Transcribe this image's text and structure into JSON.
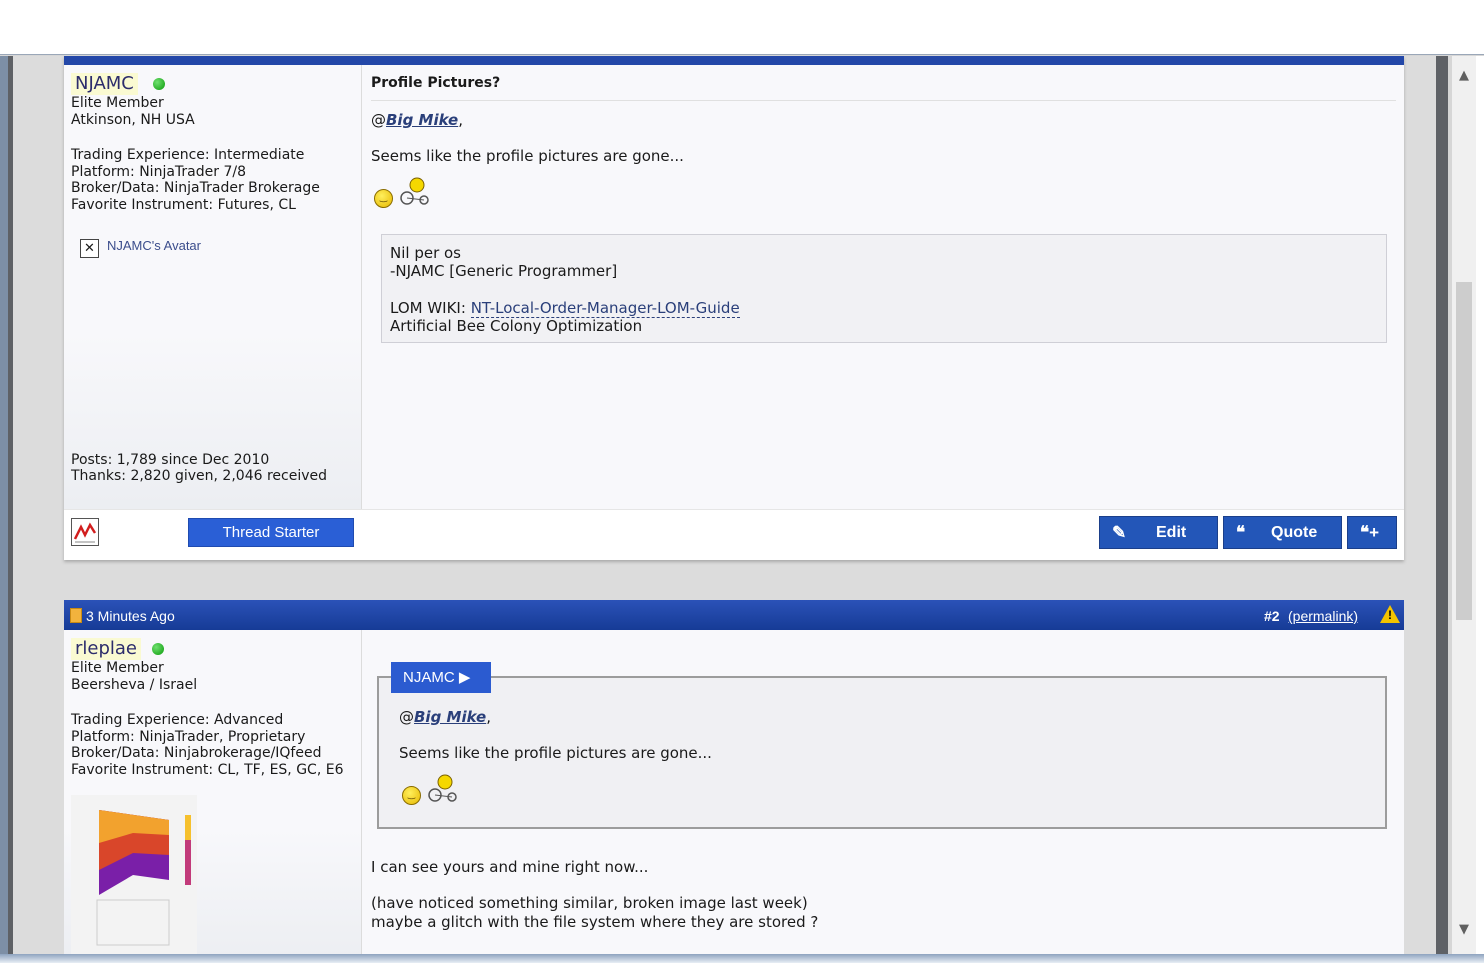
{
  "post1": {
    "user": {
      "name": "NJAMC",
      "rank": "Elite Member",
      "location": "Atkinson, NH USA",
      "experience": "Trading Experience: Intermediate",
      "platform": "Platform: NinjaTrader 7/8",
      "broker": "Broker/Data: NinjaTrader Brokerage",
      "instrument": "Favorite Instrument: Futures, CL",
      "avatar_alt": "NJAMC's Avatar",
      "posts": "Posts: 1,789 since Dec 2010",
      "thanks": "Thanks: 2,820 given, 2,046 received"
    },
    "title": "Profile Pictures?",
    "mention": "Big Mike",
    "body": "Seems like the profile pictures are gone...",
    "signature": {
      "line1": "Nil per os",
      "line2": "-NJAMC [Generic Programmer]",
      "wiki_label": "LOM WIKI: ",
      "wiki_link": "NT-Local-Order-Manager-LOM-Guide",
      "line4": "Artificial Bee Colony Optimization"
    },
    "thread_starter": "Thread Starter",
    "buttons": {
      "edit": "Edit",
      "quote": "Quote"
    }
  },
  "post2": {
    "date": "3 Minutes Ago",
    "number": "#2",
    "permalink": "(permalink)",
    "user": {
      "name": "rleplae",
      "rank": "Elite Member",
      "location": "Beersheva / Israel",
      "experience": "Trading Experience: Advanced",
      "platform": "Platform: NinjaTrader, Proprietary",
      "broker": "Broker/Data: Ninjabrokerage/IQfeed",
      "instrument": "Favorite Instrument: CL, TF, ES, GC, E6"
    },
    "quote": {
      "author": "NJAMC",
      "mention": "Big Mike",
      "body": "Seems like the profile pictures are gone..."
    },
    "body1": "I can see yours and mine right now...",
    "body2": "(have noticed something similar, broken image last week)",
    "body3": "maybe a glitch with the file system where they are stored ?"
  },
  "icons": [
    "online-icon",
    "broken-image-icon",
    "chart-icon",
    "edit-icon",
    "quote-icon",
    "multiquote-icon",
    "note-icon",
    "warning-icon",
    "smiley-icon",
    "bike-smiley-icon"
  ],
  "colors": {
    "header_blue": "#2347a8",
    "button_blue": "#2356b8",
    "online_green": "#0a9a0a",
    "username_bg": "#fafad2"
  }
}
